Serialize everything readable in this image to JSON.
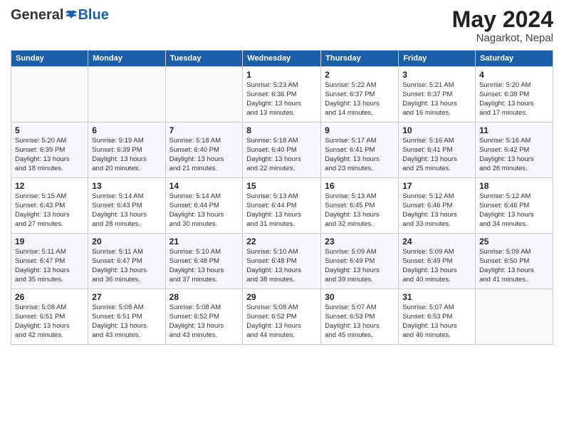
{
  "header": {
    "logo_general": "General",
    "logo_blue": "Blue",
    "month_year": "May 2024",
    "location": "Nagarkot, Nepal"
  },
  "weekdays": [
    "Sunday",
    "Monday",
    "Tuesday",
    "Wednesday",
    "Thursday",
    "Friday",
    "Saturday"
  ],
  "weeks": [
    [
      {
        "num": "",
        "detail": ""
      },
      {
        "num": "",
        "detail": ""
      },
      {
        "num": "",
        "detail": ""
      },
      {
        "num": "1",
        "detail": "Sunrise: 5:23 AM\nSunset: 6:36 PM\nDaylight: 13 hours\nand 13 minutes."
      },
      {
        "num": "2",
        "detail": "Sunrise: 5:22 AM\nSunset: 6:37 PM\nDaylight: 13 hours\nand 14 minutes."
      },
      {
        "num": "3",
        "detail": "Sunrise: 5:21 AM\nSunset: 6:37 PM\nDaylight: 13 hours\nand 16 minutes."
      },
      {
        "num": "4",
        "detail": "Sunrise: 5:20 AM\nSunset: 6:38 PM\nDaylight: 13 hours\nand 17 minutes."
      }
    ],
    [
      {
        "num": "5",
        "detail": "Sunrise: 5:20 AM\nSunset: 6:39 PM\nDaylight: 13 hours\nand 18 minutes."
      },
      {
        "num": "6",
        "detail": "Sunrise: 5:19 AM\nSunset: 6:39 PM\nDaylight: 13 hours\nand 20 minutes."
      },
      {
        "num": "7",
        "detail": "Sunrise: 5:18 AM\nSunset: 6:40 PM\nDaylight: 13 hours\nand 21 minutes."
      },
      {
        "num": "8",
        "detail": "Sunrise: 5:18 AM\nSunset: 6:40 PM\nDaylight: 13 hours\nand 22 minutes."
      },
      {
        "num": "9",
        "detail": "Sunrise: 5:17 AM\nSunset: 6:41 PM\nDaylight: 13 hours\nand 23 minutes."
      },
      {
        "num": "10",
        "detail": "Sunrise: 5:16 AM\nSunset: 6:41 PM\nDaylight: 13 hours\nand 25 minutes."
      },
      {
        "num": "11",
        "detail": "Sunrise: 5:16 AM\nSunset: 6:42 PM\nDaylight: 13 hours\nand 26 minutes."
      }
    ],
    [
      {
        "num": "12",
        "detail": "Sunrise: 5:15 AM\nSunset: 6:43 PM\nDaylight: 13 hours\nand 27 minutes."
      },
      {
        "num": "13",
        "detail": "Sunrise: 5:14 AM\nSunset: 6:43 PM\nDaylight: 13 hours\nand 28 minutes."
      },
      {
        "num": "14",
        "detail": "Sunrise: 5:14 AM\nSunset: 6:44 PM\nDaylight: 13 hours\nand 30 minutes."
      },
      {
        "num": "15",
        "detail": "Sunrise: 5:13 AM\nSunset: 6:44 PM\nDaylight: 13 hours\nand 31 minutes."
      },
      {
        "num": "16",
        "detail": "Sunrise: 5:13 AM\nSunset: 6:45 PM\nDaylight: 13 hours\nand 32 minutes."
      },
      {
        "num": "17",
        "detail": "Sunrise: 5:12 AM\nSunset: 6:46 PM\nDaylight: 13 hours\nand 33 minutes."
      },
      {
        "num": "18",
        "detail": "Sunrise: 5:12 AM\nSunset: 6:46 PM\nDaylight: 13 hours\nand 34 minutes."
      }
    ],
    [
      {
        "num": "19",
        "detail": "Sunrise: 5:11 AM\nSunset: 6:47 PM\nDaylight: 13 hours\nand 35 minutes."
      },
      {
        "num": "20",
        "detail": "Sunrise: 5:11 AM\nSunset: 6:47 PM\nDaylight: 13 hours\nand 36 minutes."
      },
      {
        "num": "21",
        "detail": "Sunrise: 5:10 AM\nSunset: 6:48 PM\nDaylight: 13 hours\nand 37 minutes."
      },
      {
        "num": "22",
        "detail": "Sunrise: 5:10 AM\nSunset: 6:48 PM\nDaylight: 13 hours\nand 38 minutes."
      },
      {
        "num": "23",
        "detail": "Sunrise: 5:09 AM\nSunset: 6:49 PM\nDaylight: 13 hours\nand 39 minutes."
      },
      {
        "num": "24",
        "detail": "Sunrise: 5:09 AM\nSunset: 6:49 PM\nDaylight: 13 hours\nand 40 minutes."
      },
      {
        "num": "25",
        "detail": "Sunrise: 5:09 AM\nSunset: 6:50 PM\nDaylight: 13 hours\nand 41 minutes."
      }
    ],
    [
      {
        "num": "26",
        "detail": "Sunrise: 5:08 AM\nSunset: 6:51 PM\nDaylight: 13 hours\nand 42 minutes."
      },
      {
        "num": "27",
        "detail": "Sunrise: 5:08 AM\nSunset: 6:51 PM\nDaylight: 13 hours\nand 43 minutes."
      },
      {
        "num": "28",
        "detail": "Sunrise: 5:08 AM\nSunset: 6:52 PM\nDaylight: 13 hours\nand 43 minutes."
      },
      {
        "num": "29",
        "detail": "Sunrise: 5:08 AM\nSunset: 6:52 PM\nDaylight: 13 hours\nand 44 minutes."
      },
      {
        "num": "30",
        "detail": "Sunrise: 5:07 AM\nSunset: 6:53 PM\nDaylight: 13 hours\nand 45 minutes."
      },
      {
        "num": "31",
        "detail": "Sunrise: 5:07 AM\nSunset: 6:53 PM\nDaylight: 13 hours\nand 46 minutes."
      },
      {
        "num": "",
        "detail": ""
      }
    ]
  ]
}
